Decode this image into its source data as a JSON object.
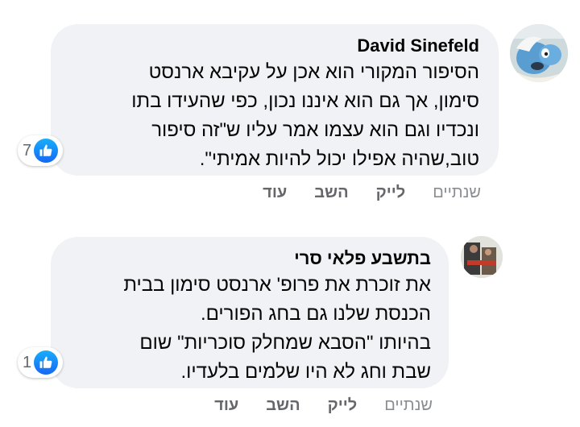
{
  "comments": [
    {
      "author": "David Sinefeld",
      "lines": [
        "הסיפור המקורי הוא אכן על עקיבא ארנסט",
        "סימון, אך גם הוא איננו נכון, כפי שהעידו בתו",
        "ונכדיו וגם הוא עצמו אמר עליו ש\"זה סיפור",
        "טוב,שהיה אפילו יכול להיות אמיתי\"."
      ],
      "reaction_count": "7",
      "reaction_icon": "thumbs-up-icon",
      "time": "שנתיים",
      "like_label": "לייק",
      "reply_label": "השב",
      "more_label": "עוד"
    },
    {
      "author": "בתשבע פלאי סרי",
      "lines": [
        "את זוכרת את פרופ' ארנסט סימון בבית",
        "הכנסת שלנו גם בחג הפורים.",
        "בהיותו \"הסבא שמחלק סוכריות\" שום",
        "שבת וחג לא היו שלמים בלעדיו."
      ],
      "reaction_count": "1",
      "reaction_icon": "thumbs-up-icon",
      "time": "שנתיים",
      "like_label": "לייק",
      "reply_label": "השב",
      "more_label": "עוד"
    }
  ],
  "colors": {
    "bubble": "#f0f2f5",
    "text": "#050505",
    "secondary": "#65676b",
    "like_blue": "#1877f2"
  }
}
